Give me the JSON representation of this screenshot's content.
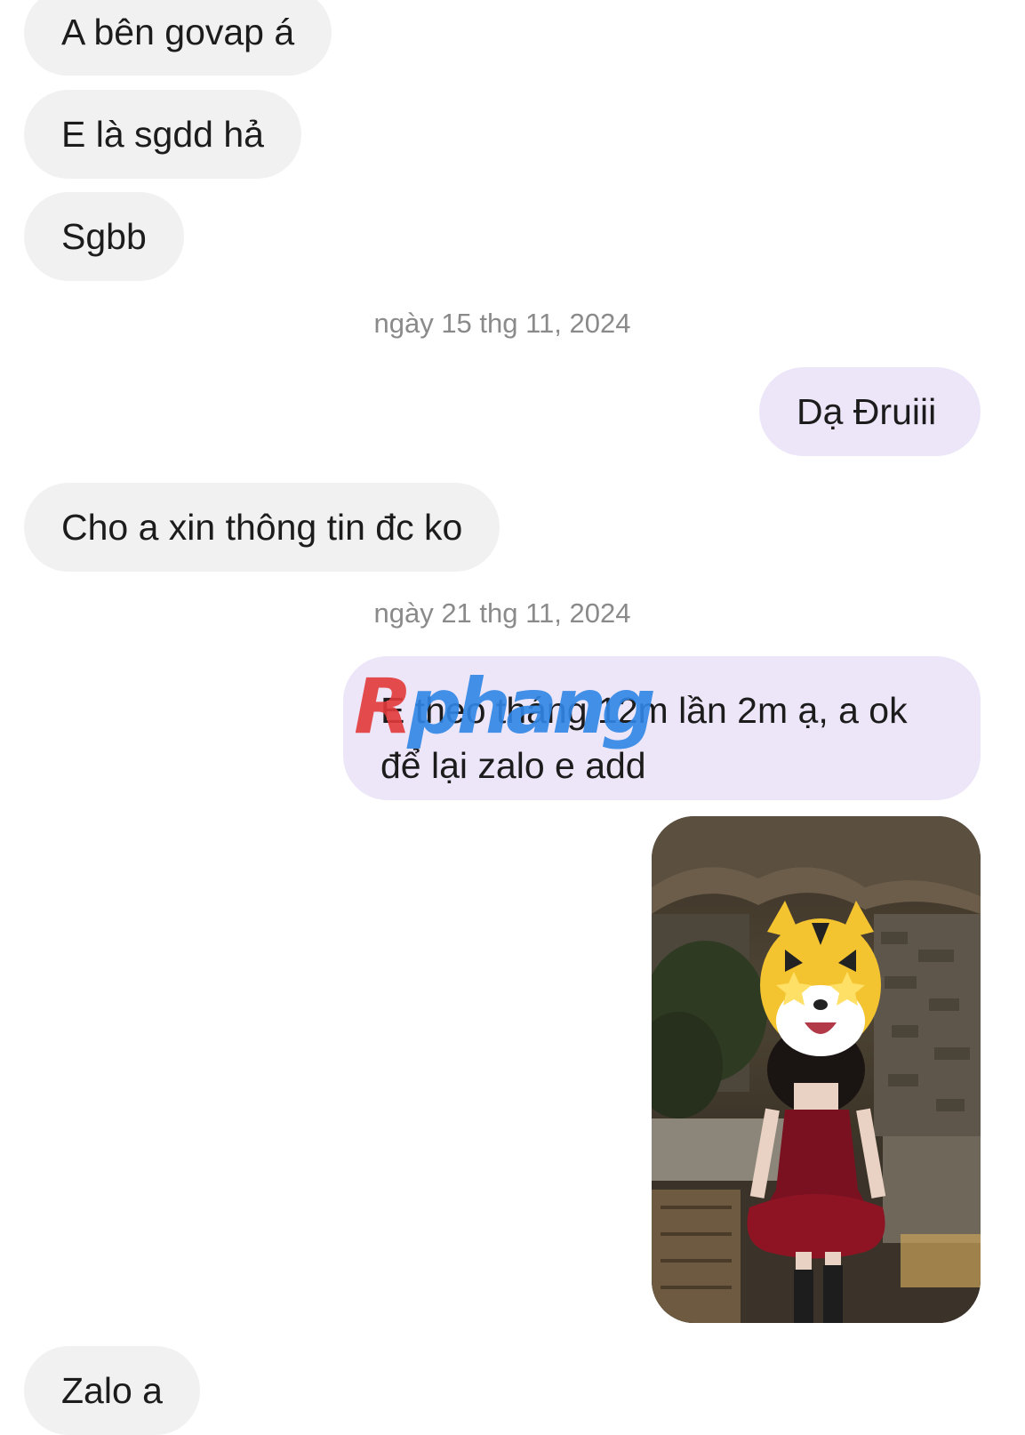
{
  "messages": [
    {
      "side": "incoming",
      "text": "A bên govap á"
    },
    {
      "side": "incoming",
      "text": "E là sgdd hả"
    },
    {
      "side": "incoming",
      "text": "Sgbb"
    },
    {
      "side": "date",
      "text": "ngày 15 thg 11, 2024"
    },
    {
      "side": "outgoing",
      "text": "Dạ Đruiii"
    },
    {
      "side": "incoming",
      "text": "Cho a xin thông tin đc ko"
    },
    {
      "side": "date",
      "text": "ngày 21 thg 11, 2024"
    },
    {
      "side": "outgoing",
      "line1": "E theo tháng 12m lần 2m ạ, a ok",
      "line2": "để lại zalo e add"
    },
    {
      "side": "outgoing",
      "type": "photo"
    },
    {
      "side": "incoming",
      "text": "Zalo a"
    }
  ],
  "watermark": {
    "first": "R",
    "rest": "phang"
  },
  "colors": {
    "incoming_bubble": "#f1f1f1",
    "outgoing_bubble": "#ede6f9",
    "date_text": "#8a8a8a",
    "watermark_red": "#e23a3a",
    "watermark_blue": "#2f86e6"
  }
}
